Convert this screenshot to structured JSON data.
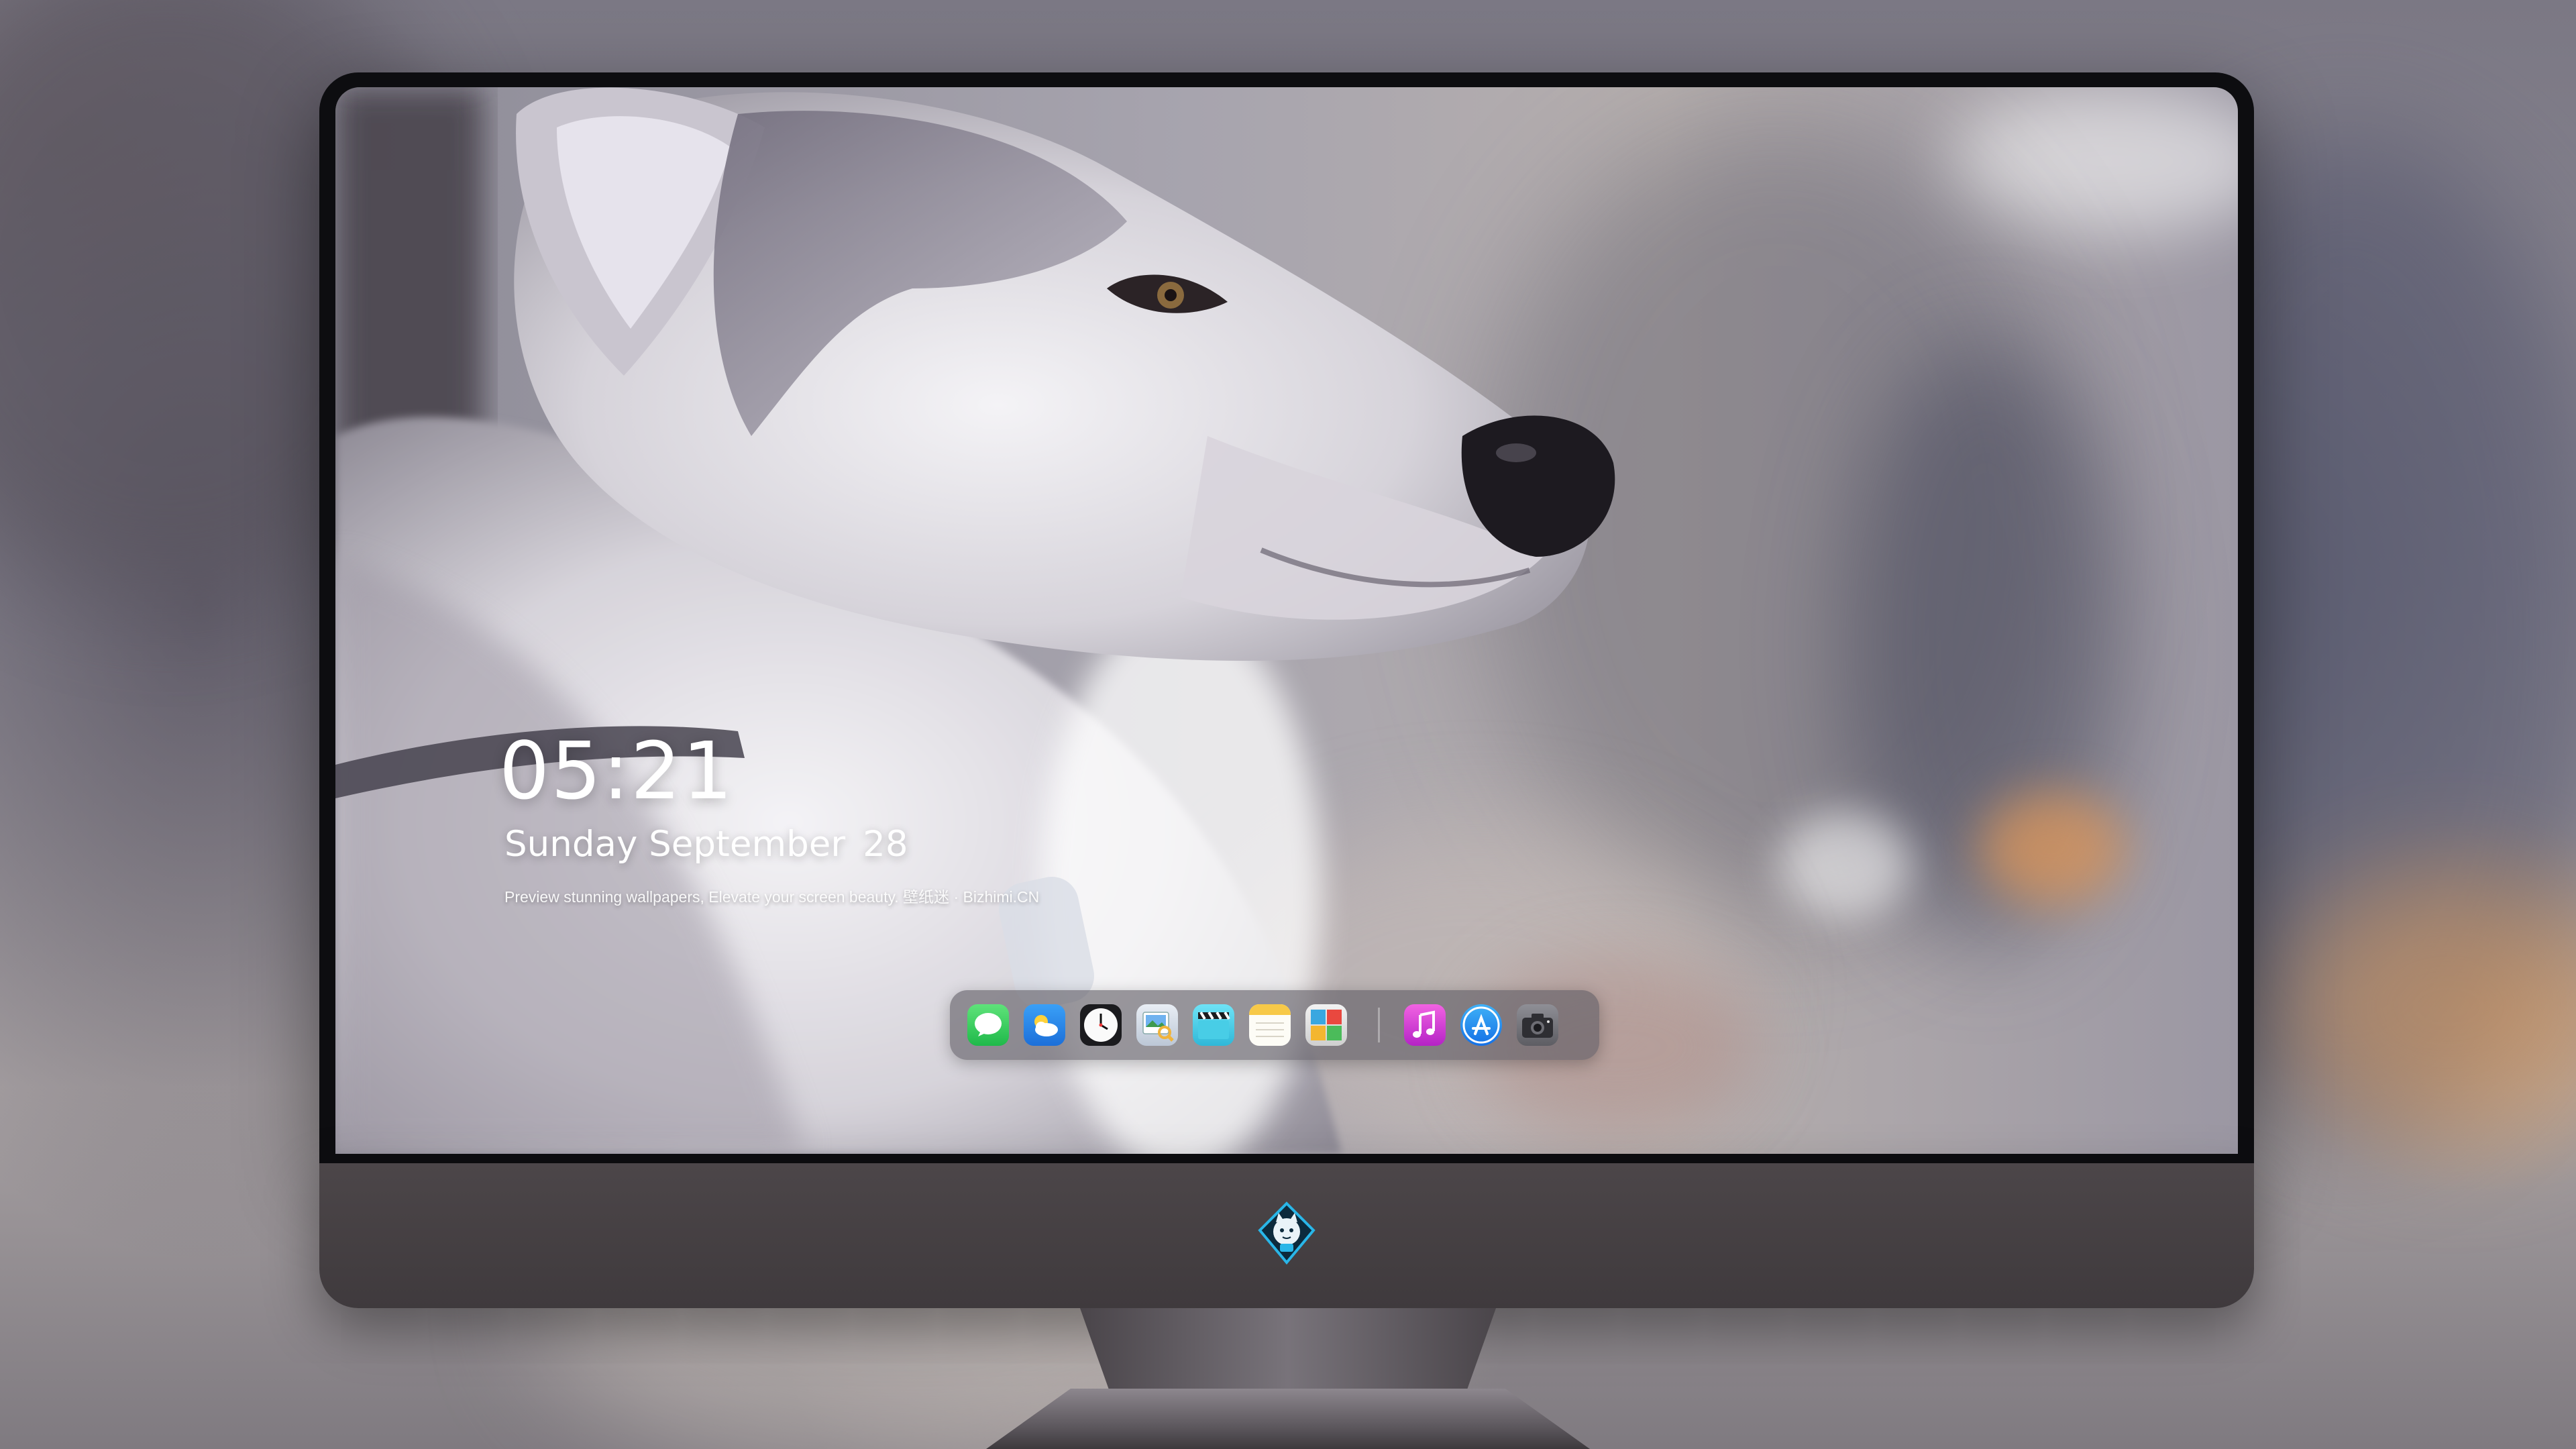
{
  "lock_screen": {
    "time": "05:21",
    "weekday_month": "Sunday September",
    "day": "28",
    "tagline": "Preview stunning wallpapers, Elevate your screen beauty. 壁纸迷 · Bizhimi.CN"
  },
  "dock": {
    "pinned_apps": [
      {
        "name": "messages-icon"
      },
      {
        "name": "weather-icon"
      },
      {
        "name": "clock-icon"
      },
      {
        "name": "preview-icon"
      },
      {
        "name": "clapperboard-icon"
      },
      {
        "name": "notes-icon"
      },
      {
        "name": "photo-booth-icon"
      }
    ],
    "extra_apps": [
      {
        "name": "music-icon"
      },
      {
        "name": "app-store-icon"
      },
      {
        "name": "camera-icon"
      }
    ]
  },
  "monitor": {
    "chin_logo": "mascot-logo-icon"
  },
  "colors": {
    "messages": "#34c759",
    "weather": "#2f8cf0",
    "music": "#e23bd0",
    "app_store": "#1c8bf2",
    "dock_bg": "#5f5c64",
    "chin": "#453f43"
  }
}
